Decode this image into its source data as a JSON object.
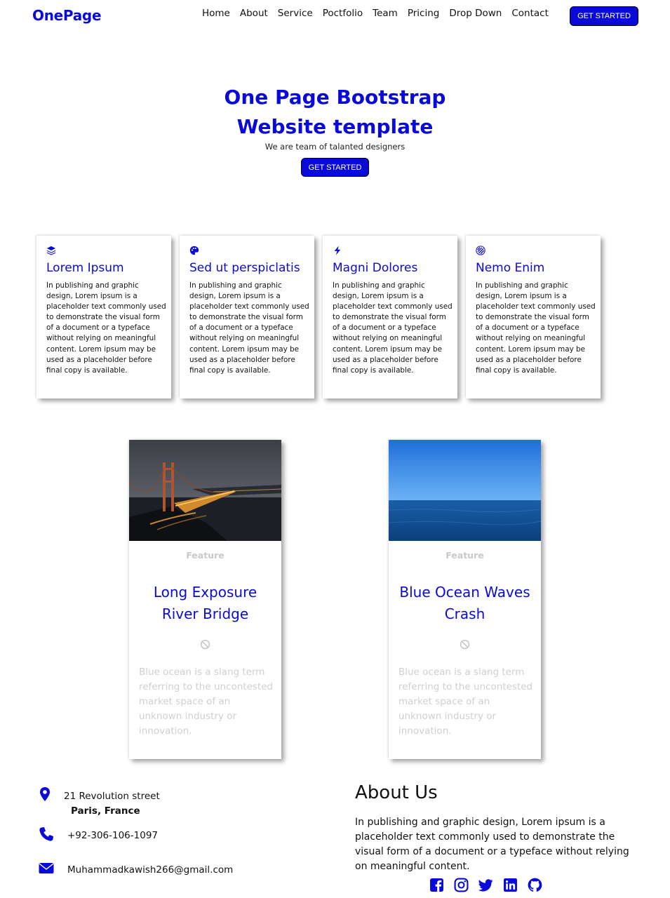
{
  "brand": "OnePage",
  "nav": {
    "items": [
      "Home",
      "About",
      "Service",
      "Poctfolio",
      "Team",
      "Pricing",
      "Drop Down",
      "Contact"
    ],
    "cta": "GET STARTED"
  },
  "hero": {
    "title_line1": "One Page Bootstrap",
    "title_line2": "Website template",
    "subtitle": "We are team of talanted designers",
    "cta": "GET STARTED"
  },
  "features": [
    {
      "icon": "layers-icon",
      "title": "Lorem Ipsum",
      "text": "In publishing and graphic design, Lorem ipsum is a placeholder text commonly used to demonstrate the visual form of a document or a typeface without relying on meaningful content. Lorem ipsum may be used as a placeholder before final copy is available."
    },
    {
      "icon": "palette-icon",
      "title": "Sed ut perspiclatis",
      "text": "In publishing and graphic design, Lorem ipsum is a placeholder text commonly used to demonstrate the visual form of a document or a typeface without relying on meaningful content. Lorem ipsum may be used as a placeholder before final copy is available."
    },
    {
      "icon": "bolt-icon",
      "title": "Magni Dolores",
      "text": "In publishing and graphic design, Lorem ipsum is a placeholder text commonly used to demonstrate the visual form of a document or a typeface without relying on meaningful content. Lorem ipsum may be used as a placeholder before final copy is available."
    },
    {
      "icon": "stripes-icon",
      "title": "Nemo Enim",
      "text": "In publishing and graphic design, Lorem ipsum is a placeholder text commonly used to demonstrate the visual form of a document or a typeface without relying on meaningful content. Lorem ipsum may be used as a placeholder before final copy is available."
    }
  ],
  "cards": [
    {
      "image": "bridge-night-photo",
      "tag": "Feature",
      "title_line1": "Long Exposure",
      "title_line2": "River Bridge",
      "icon": "ban-icon",
      "text": "Blue ocean is a slang term referring to the uncontested market space of an unknown industry or innovation."
    },
    {
      "image": "ocean-photo",
      "tag": "Feature",
      "title_line1": "Blue Ocean Waves",
      "title_line2": "Crash",
      "icon": "ban-icon",
      "text": "Blue ocean is a slang term referring to the uncontested market space of an unknown industry or innovation."
    }
  ],
  "contact": {
    "street": "21 Revolution street",
    "city": "Paris, France",
    "phone": "+92-306-106-1097",
    "email": "Muhammadkawish266@gmail.com"
  },
  "about": {
    "title": "About Us",
    "text": "In publishing and graphic design, Lorem ipsum is a placeholder text commonly used to demonstrate the visual form of a document or a typeface without relying on meaningful content."
  },
  "socials": [
    "facebook-icon",
    "instagram-icon",
    "twitter-icon",
    "linkedin-icon",
    "github-icon"
  ],
  "colors": {
    "accent": "#0a0ad8",
    "muted": "#cfcfcf"
  }
}
